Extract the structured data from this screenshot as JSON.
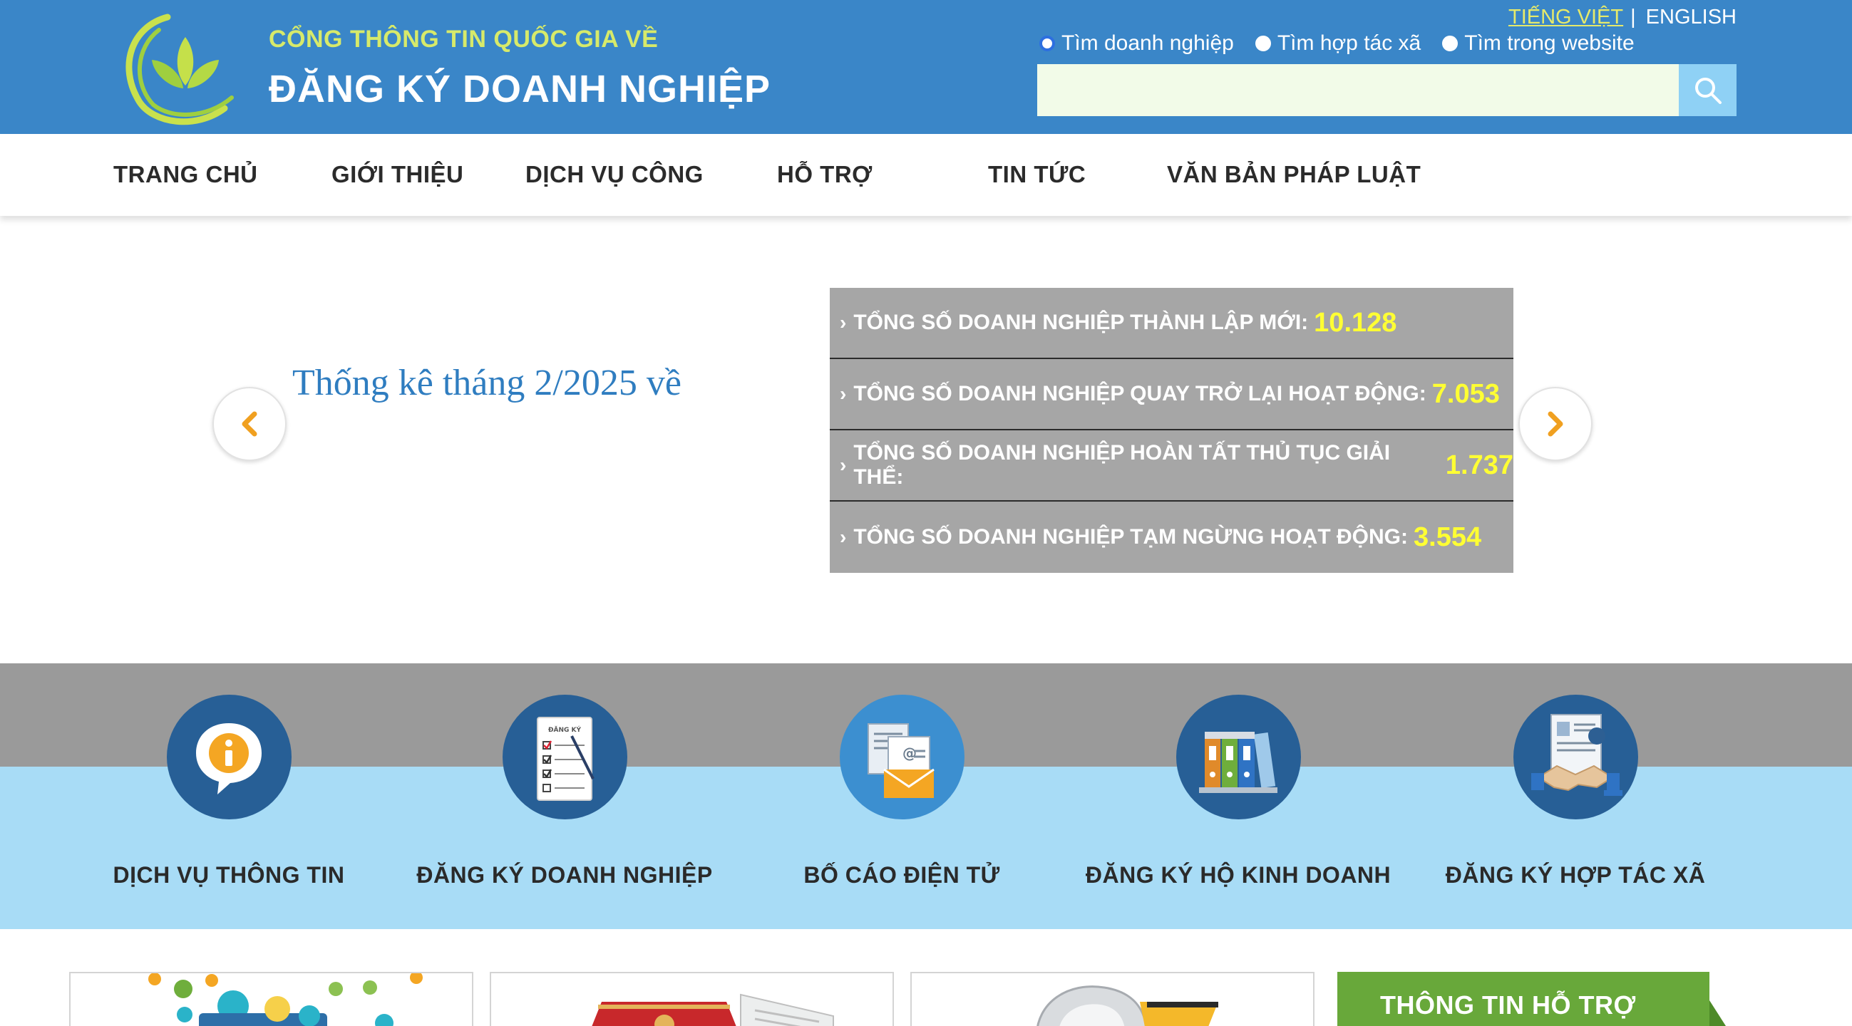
{
  "header": {
    "brand_sub": "CỔNG THÔNG TIN QUỐC GIA VỀ",
    "brand_main": "ĐĂNG KÝ DOANH NGHIỆP",
    "lang_vi": "TIẾNG VIỆT",
    "lang_sep": "|",
    "lang_en": "ENGLISH",
    "search_options": [
      {
        "label": "Tìm doanh nghiệp",
        "selected": true
      },
      {
        "label": "Tìm hợp tác xã",
        "selected": false
      },
      {
        "label": "Tìm trong website",
        "selected": false
      }
    ],
    "search_value": "",
    "colors": {
      "header_bg": "#3a86c8",
      "search_btn": "#8fd1f5",
      "brand_sub": "#d7ea6a"
    }
  },
  "nav": {
    "items": [
      "TRANG CHỦ",
      "GIỚI THIỆU",
      "DỊCH VỤ CÔNG",
      "HỖ TRỢ",
      "TIN TỨC",
      "VĂN BẢN PHÁP LUẬT"
    ]
  },
  "slider": {
    "title": "Thống kê tháng 2/2025 về",
    "stats": [
      {
        "label": "TỔNG SỐ DOANH NGHIỆP THÀNH LẬP MỚI:",
        "value": "10.128"
      },
      {
        "label": "TỔNG SỐ DOANH NGHIỆP QUAY TRỞ LẠI HOẠT ĐỘNG:",
        "value": "7.053"
      },
      {
        "label": "TỔNG SỐ DOANH NGHIỆP HOÀN TẤT THỦ TỤC GIẢI THỂ:",
        "value": "1.737"
      },
      {
        "label": "TỔNG SỐ DOANH NGHIỆP TẠM NGỪNG HOẠT ĐỘNG:",
        "value": "3.554"
      }
    ]
  },
  "services": [
    {
      "label": "DỊCH VỤ THÔNG TIN",
      "icon": "info-bubble-icon"
    },
    {
      "label": "ĐĂNG KÝ DOANH NGHIỆP",
      "icon": "registration-form-icon",
      "form_title": "ĐĂNG KÝ"
    },
    {
      "label": "BỐ CÁO ĐIỆN TỬ",
      "icon": "email-document-icon"
    },
    {
      "label": "ĐĂNG KÝ HỘ KINH DOANH",
      "icon": "binders-icon"
    },
    {
      "label": "ĐĂNG KÝ HỢP TÁC XÃ",
      "icon": "handshake-contract-icon"
    }
  ],
  "support": {
    "label": "THÔNG TIN HỖ TRỢ"
  }
}
